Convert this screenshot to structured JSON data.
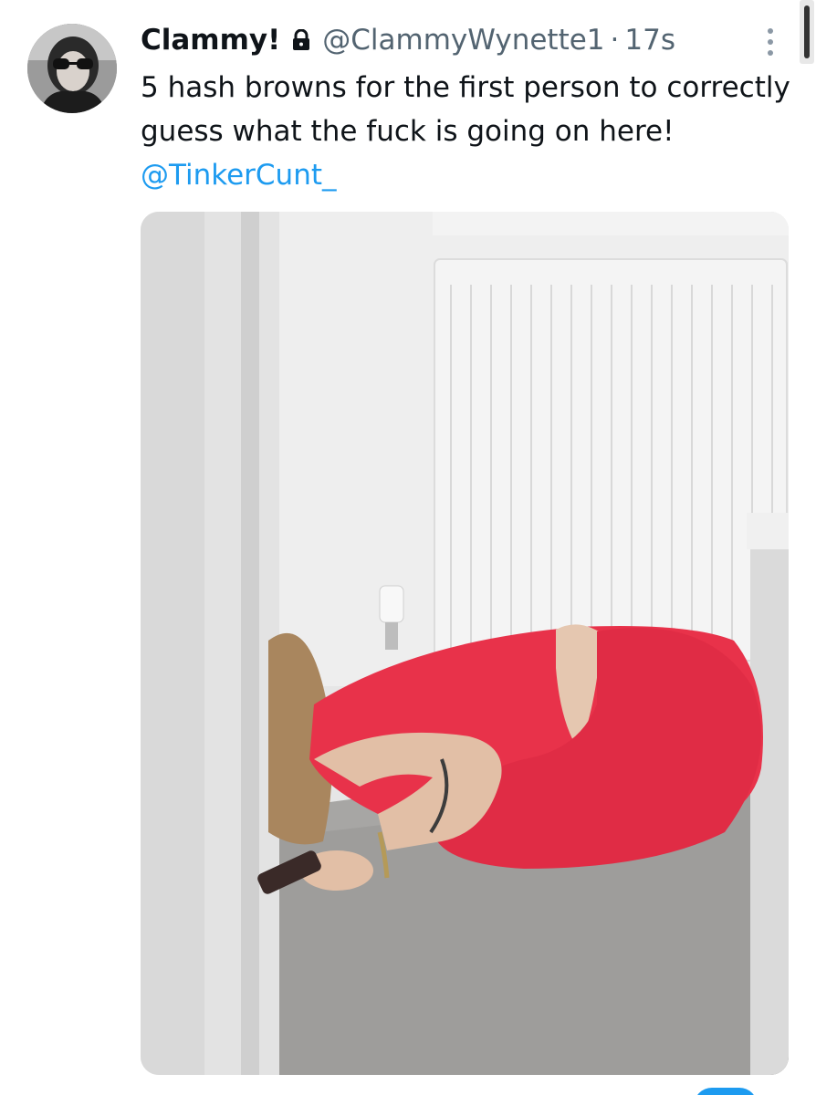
{
  "tweet": {
    "display_name": "Clammy!",
    "handle": "@ClammyWynette1",
    "separator": "·",
    "time": "17s",
    "text": "5 hash browns for the first person to correctly guess what the fuck is going on here! ",
    "mention": "@TinkerCunt_",
    "protected_icon": "lock-icon",
    "menu_icon": "more-vertical-icon"
  },
  "colors": {
    "text": "#0f1419",
    "secondary": "#536471",
    "link": "#1d9bf0",
    "outfit": "#e8324a"
  }
}
